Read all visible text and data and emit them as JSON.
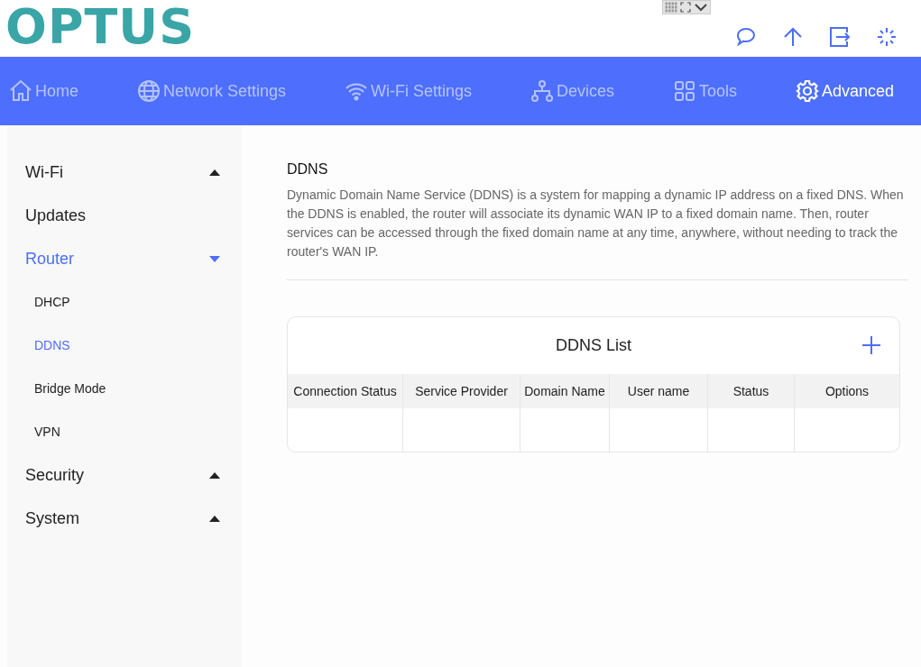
{
  "logo": "OPTUS",
  "header_icons": [
    {
      "kind": "chat"
    },
    {
      "kind": "upload"
    },
    {
      "kind": "logout"
    },
    {
      "kind": "spinner"
    }
  ],
  "nav": [
    {
      "label": "Home",
      "kind": "home",
      "selected": false
    },
    {
      "label": "Network Settings",
      "kind": "globe",
      "selected": false
    },
    {
      "label": "Wi-Fi Settings",
      "kind": "wifi",
      "selected": false
    },
    {
      "label": "Devices",
      "kind": "devices",
      "selected": false
    },
    {
      "label": "Tools",
      "kind": "tools",
      "selected": false
    },
    {
      "label": "Advanced",
      "kind": "gear",
      "selected": true
    }
  ],
  "sidebar": [
    {
      "label": "Wi-Fi",
      "kind": "group",
      "expanded": false
    },
    {
      "label": "Updates",
      "kind": "link"
    },
    {
      "label": "Router",
      "kind": "group",
      "expanded": true,
      "children": [
        {
          "label": "DHCP",
          "selected": false
        },
        {
          "label": "DDNS",
          "selected": true
        },
        {
          "label": "Bridge Mode",
          "selected": false
        },
        {
          "label": "VPN",
          "selected": false
        }
      ]
    },
    {
      "label": "Security",
      "kind": "group",
      "expanded": false
    },
    {
      "label": "System",
      "kind": "group",
      "expanded": false
    }
  ],
  "section": {
    "title": "DDNS",
    "description": "Dynamic Domain Name Service (DDNS) is a system for mapping a dynamic IP address on a fixed DNS. When the DDNS is enabled, the router will associate its dynamic WAN IP to a fixed domain name. Then, router services can be accessed through the fixed domain name at any time, anywhere, without needing to track the router's WAN IP."
  },
  "table": {
    "title": "DDNS List",
    "columns": [
      "Connection Status",
      "Service Provider",
      "Domain Name",
      "User name",
      "Status",
      "Options"
    ]
  }
}
